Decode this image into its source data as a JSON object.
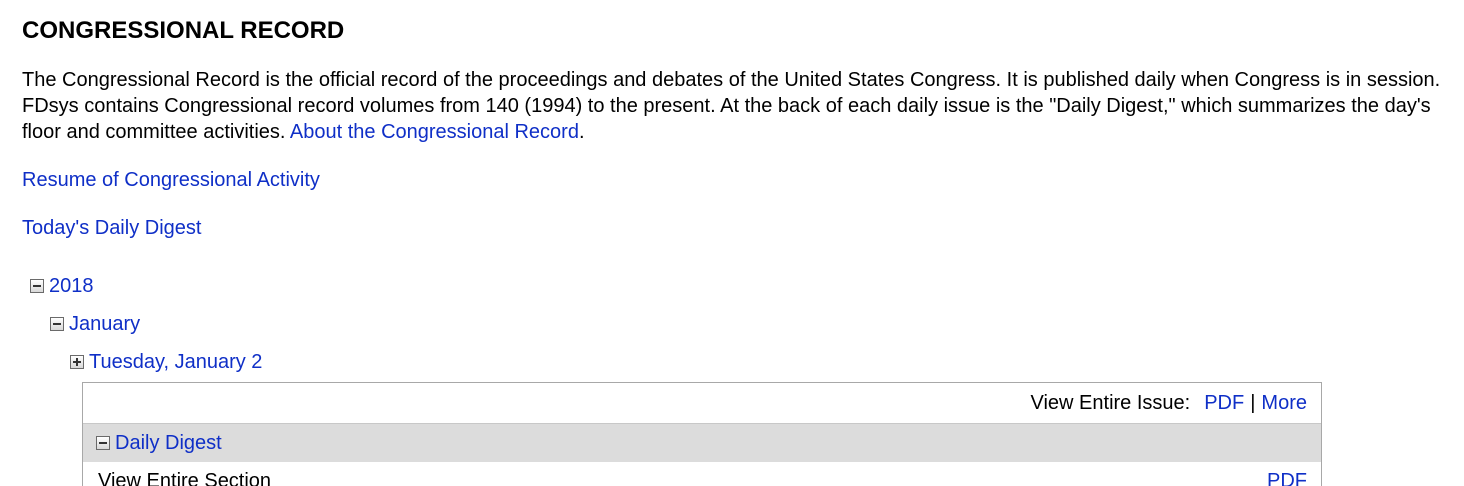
{
  "header": {
    "title": "CONGRESSIONAL RECORD"
  },
  "intro": {
    "text": "The Congressional Record is the official record of the proceedings and debates of the United States Congress. It is published daily when Congress is in session. FDsys contains Congressional record volumes from 140 (1994) to the present. At the back of each daily issue is the \"Daily Digest,\" which summarizes the day's floor and committee activities.",
    "link_label": "About the Congressional Record",
    "trailing": "."
  },
  "links": {
    "resume": "Resume of Congressional Activity",
    "daily_digest": "Today's Daily Digest"
  },
  "tree": {
    "year": {
      "label": "2018",
      "expanded": true
    },
    "month": {
      "label": "January",
      "expanded": true
    },
    "day": {
      "label": "Tuesday, January 2",
      "expanded": false
    }
  },
  "issue": {
    "view_label": "View Entire Issue:",
    "pdf_label": "PDF",
    "separator": "|",
    "more_label": "More",
    "section": {
      "title": "Daily Digest",
      "expanded": true,
      "row_label": "View Entire Section",
      "row_pdf": "PDF"
    }
  },
  "colors": {
    "link": "#0f2fc7",
    "section_bar": "#dcdcdc",
    "border": "#a8a8a8"
  },
  "icons": {
    "collapse": "minus-box-icon",
    "expand": "plus-box-icon"
  }
}
